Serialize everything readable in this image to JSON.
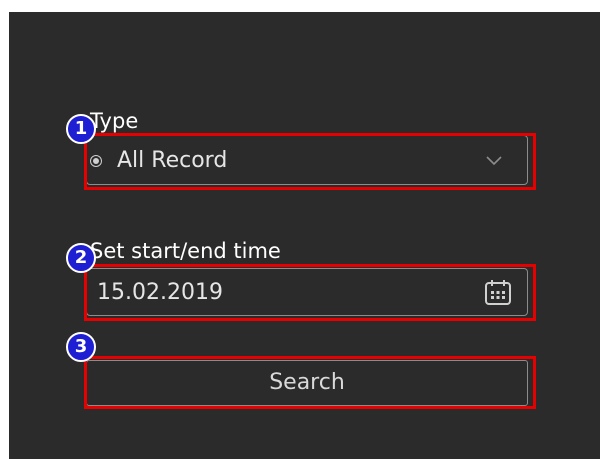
{
  "type_section": {
    "label": "Type",
    "selected": "All Record"
  },
  "time_section": {
    "label": "Set start/end time",
    "value": "15.02.2019"
  },
  "search": {
    "label": "Search"
  },
  "badges": [
    "1",
    "2",
    "3"
  ],
  "icons": {
    "dropdown": "chevron-down-icon",
    "calendar": "calendar-icon",
    "radio": "radio-dot-icon"
  },
  "colors": {
    "panel_bg": "#2b2b2b",
    "highlight": "#e60000",
    "badge": "#1e1ed2"
  }
}
